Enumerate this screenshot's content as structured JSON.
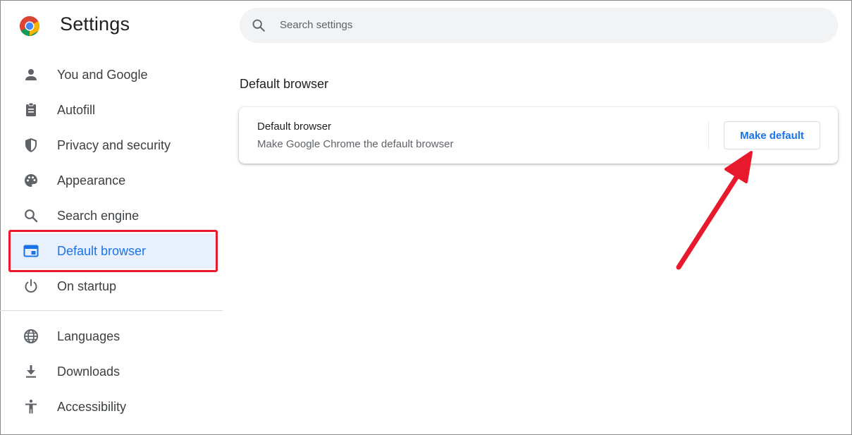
{
  "app": {
    "title": "Settings"
  },
  "search": {
    "placeholder": "Search settings"
  },
  "sidebar": {
    "items": [
      {
        "label": "You and Google",
        "icon": "person-icon"
      },
      {
        "label": "Autofill",
        "icon": "clipboard-icon"
      },
      {
        "label": "Privacy and security",
        "icon": "shield-icon"
      },
      {
        "label": "Appearance",
        "icon": "palette-icon"
      },
      {
        "label": "Search engine",
        "icon": "search-icon"
      },
      {
        "label": "Default browser",
        "icon": "browser-window-icon",
        "active": true
      },
      {
        "label": "On startup",
        "icon": "power-icon"
      },
      {
        "label": "Languages",
        "icon": "globe-icon"
      },
      {
        "label": "Downloads",
        "icon": "download-icon"
      },
      {
        "label": "Accessibility",
        "icon": "accessibility-icon"
      }
    ]
  },
  "main": {
    "section_title": "Default browser",
    "card": {
      "title": "Default browser",
      "subtitle": "Make Google Chrome the default browser",
      "button_label": "Make default"
    }
  },
  "colors": {
    "accent": "#1a73e8",
    "active_bg": "#e8f0fe",
    "annotation_red": "#e8192c"
  }
}
